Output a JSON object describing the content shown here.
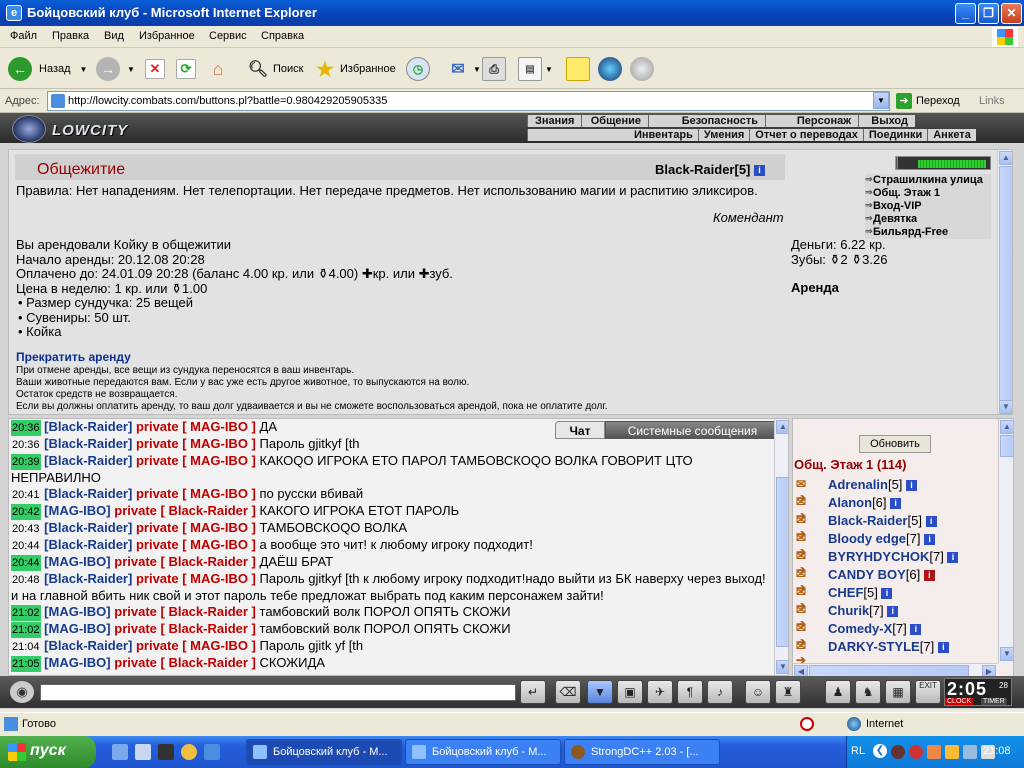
{
  "window": {
    "title": "Бойцовский клуб - Microsoft Internet Explorer"
  },
  "menu": [
    "Файл",
    "Правка",
    "Вид",
    "Избранное",
    "Сервис",
    "Справка"
  ],
  "toolbar": {
    "back": "Назад",
    "search": "Поиск",
    "favorites": "Избранное"
  },
  "address": {
    "label": "Адрес:",
    "url": "http://lowcity.combats.com/buttons.pl?battle=0.980429205905335",
    "go": "Переход",
    "links": "Links"
  },
  "game": {
    "logo": "LOWCITY",
    "nav_top": [
      "Знания",
      "Общение",
      "Безопасность",
      "Персонаж",
      "Выход"
    ],
    "nav_bottom": [
      "Инвентарь",
      "Умения",
      "Отчет о переводах",
      "Поединки",
      "Анкета"
    ]
  },
  "room": {
    "title": "Общежитие",
    "player": "Black-Raider",
    "player_level": "[5]",
    "rules": "Правила: Нет нападениям. Нет телепортации. Нет передаче предметов. Нет использованию магии и распитию эликсиров.",
    "commandant": "Комендант",
    "rent_lines": [
      "Вы арендовали Койку в общежитии",
      "Начало аренды: 20.12.08 20:28",
      "Оплачено до: 24.01.09 20:28 (баланс 4.00 кр. или ⚱4.00) ✚кр. или ✚зуб.",
      "Цена в неделю: 1 кр. или ⚱1.00"
    ],
    "rent_items": [
      "Размер сундучка: 25 вещей",
      "Сувениры: 50 шт.",
      "Койка"
    ],
    "cancel": "Прекратить аренду",
    "notes": [
      "При отмене аренды, все вещи из сундука переносятся в ваш инвентарь.",
      "Ваши животные передаются вам. Если у вас уже есть другое животное, то выпускаются на волю.",
      "Остаток средств не возвращается.",
      "Если вы должны оплатить аренду, то ваш долг удваивается и вы не сможете воспользоваться арендой, пока не оплатите долг."
    ],
    "locations": [
      "Страшилкина улица",
      "Общ. Этаж 1",
      "Вход-VIP",
      "Девятка",
      "Бильярд-Free"
    ],
    "money": "Деньги: 6.22 кр.",
    "teeth": "Зубы: ⚱2 ⚱3.26",
    "arenda": "Аренда"
  },
  "chat": {
    "tab_chat": "Чат",
    "tab_system": "Системные сообщения",
    "lines": [
      {
        "time": "20:36",
        "hl": true,
        "from": "Black-Raider",
        "to": "MAG-IBO",
        "msg": "ДА"
      },
      {
        "time": "20:36",
        "hl": false,
        "from": "Black-Raider",
        "to": "MAG-IBO",
        "msg": "Пароль gjitkyf [th"
      },
      {
        "time": "20:39",
        "hl": true,
        "from": "Black-Raider",
        "to": "MAG-IBO",
        "msg": "КАКОQО ИГРОКА ЕТО ПАРОЛ ТАМБОВСКОQО ВОЛКА ГОВОРИТ ЦТО НЕПРАВИЛНО"
      },
      {
        "time": "20:41",
        "hl": false,
        "from": "Black-Raider",
        "to": "MAG-IBO",
        "msg": "по русски вбивай"
      },
      {
        "time": "20:42",
        "hl": true,
        "from": "MAG-IBO",
        "to": "Black-Raider",
        "msg": "КАКОГО ИГРОКА ЕТОТ ПАРОЛЬ"
      },
      {
        "time": "20:43",
        "hl": false,
        "from": "Black-Raider",
        "to": "MAG-IBO",
        "msg": "ТАМБОВСКОQО ВОЛКА"
      },
      {
        "time": "20:44",
        "hl": false,
        "from": "Black-Raider",
        "to": "MAG-IBO",
        "msg": "а вообще это чит! к любому игроку подходит!"
      },
      {
        "time": "20:44",
        "hl": true,
        "from": "MAG-IBO",
        "to": "Black-Raider",
        "msg": "ДАЁШ БРАТ"
      },
      {
        "time": "20:48",
        "hl": false,
        "from": "Black-Raider",
        "to": "MAG-IBO",
        "msg": "Пароль gjitkyf [th к любому игроку подходит!надо выйти из БК наверху через выход! и на главной вбить ник свой и этот пароль тебе предложат выбрать под каким персонажем зайти!"
      },
      {
        "time": "21:02",
        "hl": true,
        "from": "MAG-IBO",
        "to": "Black-Raider",
        "msg": "тамбовский волк ПОРОЛ ОПЯТЬ СКОЖИ"
      },
      {
        "time": "21:02",
        "hl": true,
        "from": "MAG-IBO",
        "to": "Black-Raider",
        "msg": "тамбовский волк ПОРОЛ ОПЯТЬ СКОЖИ"
      },
      {
        "time": "21:04",
        "hl": false,
        "from": "Black-Raider",
        "to": "MAG-IBO",
        "msg": "Пароль gjitk yf [th"
      },
      {
        "time": "21:05",
        "hl": true,
        "from": "MAG-IBO",
        "to": "Black-Raider",
        "msg": "СКОЖИДА"
      }
    ],
    "private_word": "private"
  },
  "userlist": {
    "refresh": "Обновить",
    "room": "Общ. Этаж 1 (114)",
    "users": [
      {
        "name": "Adrenalin",
        "level": "[5]",
        "info": "blue"
      },
      {
        "name": "Alanon",
        "level": "[6]",
        "info": "blue"
      },
      {
        "name": "Black-Raider",
        "level": "[5]",
        "info": "blue"
      },
      {
        "name": "Bloody edge",
        "level": "[7]",
        "info": "blue"
      },
      {
        "name": "BYRYHDYCHOK",
        "level": "[7]",
        "info": "blue"
      },
      {
        "name": "CANDY BOY",
        "level": "[6]",
        "info": "red"
      },
      {
        "name": "CHEF",
        "level": "[5]",
        "info": "blue"
      },
      {
        "name": "Churik",
        "level": "[7]",
        "info": "blue"
      },
      {
        "name": "Comedy-X",
        "level": "[7]",
        "info": "blue"
      },
      {
        "name": "DARKY-STYLE",
        "level": "[7]",
        "info": "blue"
      }
    ]
  },
  "clock": {
    "time": "2:05",
    "sec": "28",
    "labels": [
      "CLOCK",
      "TIMER"
    ],
    "exit": "EXIT"
  },
  "status": {
    "text": "Готово",
    "zone": "Internet"
  },
  "taskbar": {
    "start": "пуск",
    "tasks": [
      "Бойцовский клуб - M...",
      "Бойцовский клуб - M...",
      "StrongDC++ 2.03 - [..."
    ],
    "lang": "RL",
    "time": "21:08"
  }
}
